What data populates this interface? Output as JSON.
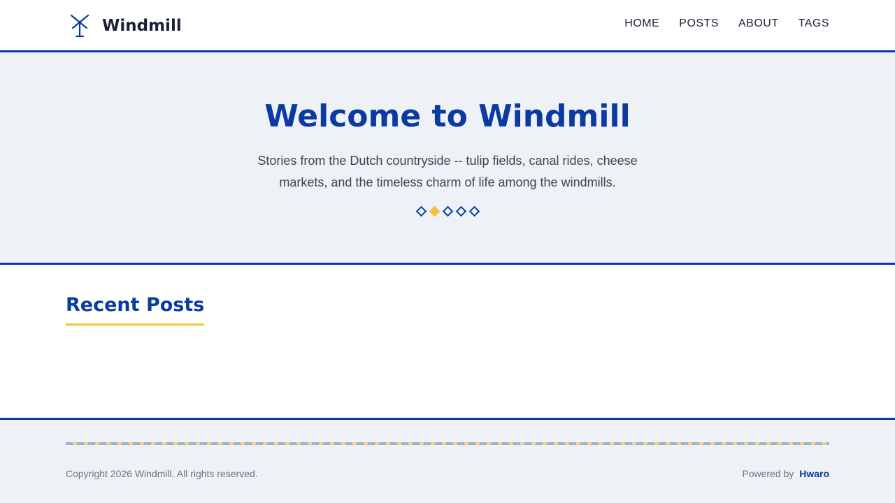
{
  "header": {
    "logo_text": "Windmill",
    "logo_icon": "windmill-icon",
    "nav": [
      {
        "label": "HOME"
      },
      {
        "label": "POSTS"
      },
      {
        "label": "ABOUT"
      },
      {
        "label": "TAGS"
      }
    ]
  },
  "hero": {
    "title": "Welcome to Windmill",
    "subtitle": "Stories from the Dutch countryside -- tulip fields, canal rides, cheese markets, and the timeless charm of life among the windmills.",
    "indicators": {
      "count": 5,
      "active_index": 1
    }
  },
  "recent_posts": {
    "title": "Recent Posts"
  },
  "footer": {
    "copyright": "Copyright 2026 Windmill. All rights reserved.",
    "powered_prefix": "Powered by",
    "powered_link": "Hwaro"
  },
  "colors": {
    "brand_blue": "#0b3aa0",
    "accent_yellow": "#f5c33b",
    "hero_bg": "#eef2f7",
    "text_dark": "#1b2236"
  }
}
